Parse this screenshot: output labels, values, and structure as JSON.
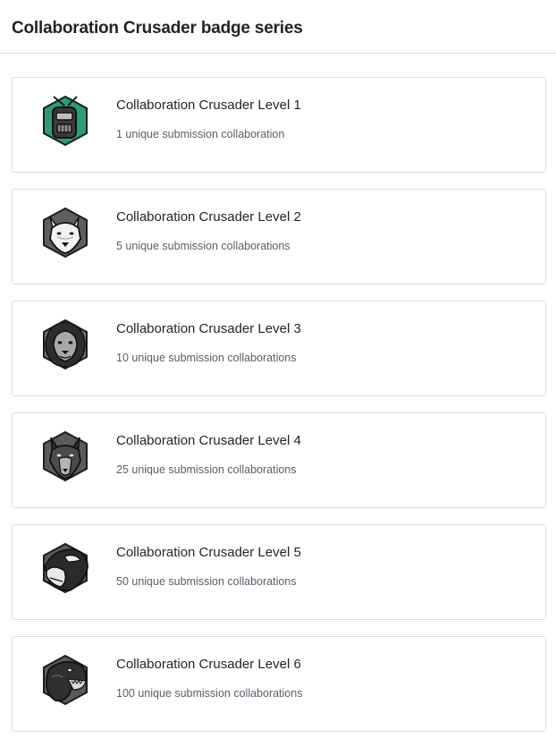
{
  "header": {
    "title": "Collaboration Crusader badge series"
  },
  "badges": [
    {
      "title": "Collaboration Crusader Level 1",
      "description": "1 unique submission collaboration",
      "icon": "robot-badge-icon",
      "accent": "#2a9d75"
    },
    {
      "title": "Collaboration Crusader Level 2",
      "description": "5 unique submission collaborations",
      "icon": "wolf-badge-icon",
      "accent": "#6b6b6b"
    },
    {
      "title": "Collaboration Crusader Level 3",
      "description": "10 unique submission collaborations",
      "icon": "lion-badge-icon",
      "accent": "#4a4a4a"
    },
    {
      "title": "Collaboration Crusader Level 4",
      "description": "25 unique submission collaborations",
      "icon": "wolf-head-badge-icon",
      "accent": "#4a4a4a"
    },
    {
      "title": "Collaboration Crusader Level 5",
      "description": "50 unique submission collaborations",
      "icon": "orca-badge-icon",
      "accent": "#3a3a3a"
    },
    {
      "title": "Collaboration Crusader Level 6",
      "description": "100 unique submission collaborations",
      "icon": "dinosaur-badge-icon",
      "accent": "#3a3a3a"
    }
  ]
}
